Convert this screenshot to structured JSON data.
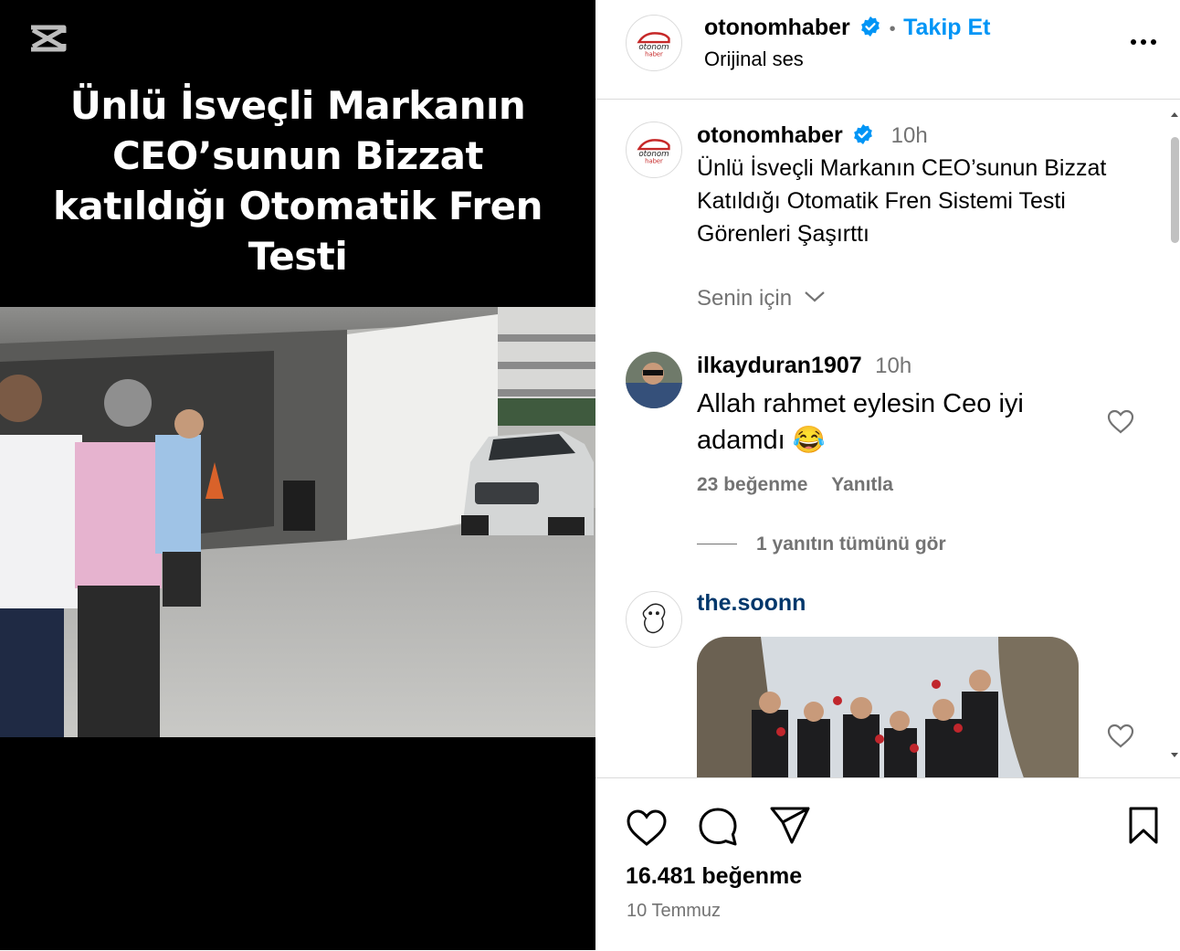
{
  "media": {
    "overlay_title": "Ünlü İsveçli Markanın CEO’sunun Bizzat katıldığı Otomatik Fren Testi"
  },
  "header": {
    "username": "otonomhaber",
    "separator": "•",
    "follow_label": "Takip Et",
    "audio": "Orijinal ses",
    "avatar_text": "otonom",
    "avatar_subtext": "haber"
  },
  "caption": {
    "username": "otonomhaber",
    "time": "10h",
    "text": "Ünlü İsveçli Markanın CEO’sunun Bizzat Katıldığı Otomatik Fren Sistemi Testi Görenleri Şaşırttı",
    "avatar_text": "otonom",
    "avatar_subtext": "haber"
  },
  "senin_icin": "Senin için",
  "comments": [
    {
      "username": "ilkayduran1907",
      "time": "10h",
      "text": "Allah rahmet eylesin Ceo iyi adamdı 😂",
      "likes": "23 beğenme",
      "reply_label": "Yanıtla",
      "view_replies": "1 yanıtın tümünü gör"
    },
    {
      "username": "the.soonn"
    }
  ],
  "footer": {
    "likes": "16.481 beğenme",
    "date": "10 Temmuz"
  },
  "colors": {
    "accent": "#0095f6",
    "muted": "#737373",
    "border": "#dbdbdb",
    "verified": "#0095f6"
  }
}
